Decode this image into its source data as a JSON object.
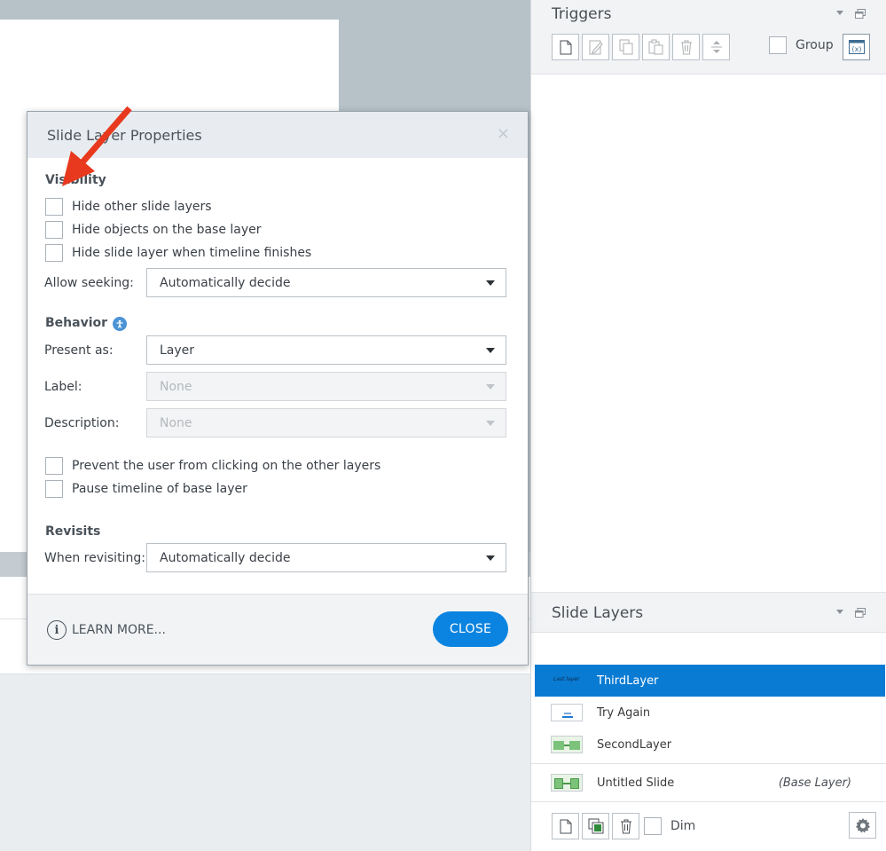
{
  "triggers_panel": {
    "title": "Triggers",
    "group_label": "Group"
  },
  "dialog": {
    "title": "Slide Layer Properties",
    "close_icon": "×",
    "visibility": {
      "title": "Visibility",
      "options": [
        "Hide other slide layers",
        "Hide objects on the base layer",
        "Hide slide layer when timeline finishes"
      ],
      "allow_seeking_label": "Allow seeking:",
      "allow_seeking_value": "Automatically decide"
    },
    "behavior": {
      "title": "Behavior",
      "present_as_label": "Present as:",
      "present_as_value": "Layer",
      "label_label": "Label:",
      "label_value": "None",
      "description_label": "Description:",
      "description_value": "None",
      "options": [
        "Prevent the user from clicking on the other layers",
        "Pause timeline of base layer"
      ]
    },
    "revisits": {
      "title": "Revisits",
      "when_revisiting_label": "When revisiting:",
      "when_revisiting_value": "Automatically decide"
    },
    "learn_more": "LEARN MORE...",
    "close_button": "CLOSE"
  },
  "slide_layers_panel": {
    "title": "Slide Layers",
    "layers": [
      {
        "name": "ThirdLayer",
        "thumb_text": "Last layer",
        "selected": true
      },
      {
        "name": "Try Again",
        "selected": false
      },
      {
        "name": "SecondLayer",
        "selected": false
      }
    ],
    "base_layer": {
      "name": "Untitled Slide",
      "tag": "(Base Layer)"
    },
    "dim_label": "Dim"
  },
  "colors": {
    "accent": "#0a84e0",
    "selected_row": "#0a7bd3",
    "annotation_arrow": "#e8391e"
  }
}
